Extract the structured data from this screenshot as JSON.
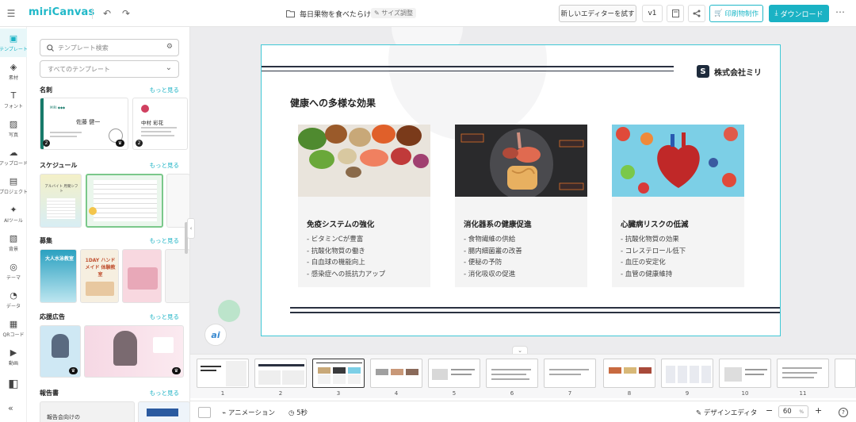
{
  "app": {
    "logo": "miriCanvas"
  },
  "topbar": {
    "doc_title": "毎日果物を食べたらけれ…",
    "size_label": "サイズ調整",
    "try_editor": "新しいエディターを試す",
    "version": "v1",
    "print_label": "印刷物制作",
    "download_label": "ダウンロード"
  },
  "rail": {
    "items": [
      {
        "label": "テンプレート",
        "icon": "template-icon"
      },
      {
        "label": "素材",
        "icon": "elements-icon"
      },
      {
        "label": "フォント",
        "icon": "font-icon"
      },
      {
        "label": "写真",
        "icon": "photo-icon"
      },
      {
        "label": "アップロード",
        "icon": "upload-icon"
      },
      {
        "label": "プロジェクト",
        "icon": "project-icon"
      },
      {
        "label": "AIツール",
        "icon": "ai-tool-icon"
      },
      {
        "label": "背景",
        "icon": "background-icon"
      },
      {
        "label": "テーマ",
        "icon": "theme-icon"
      },
      {
        "label": "データ",
        "icon": "data-icon"
      },
      {
        "label": "QRコード",
        "icon": "qr-icon"
      },
      {
        "label": "動画",
        "icon": "video-icon"
      },
      {
        "label": "",
        "icon": "bookmark-icon"
      }
    ]
  },
  "panel": {
    "search_placeholder": "テンプレート検索",
    "select_value": "すべてのテンプレート",
    "more_label": "もっと見る",
    "categories": [
      {
        "title": "名刺",
        "more": "もっと見る"
      },
      {
        "title": "スケジュール",
        "more": "もっと見る"
      },
      {
        "title": "募集",
        "more": "もっと見る"
      },
      {
        "title": "応援広告",
        "more": "もっと見る"
      },
      {
        "title": "報告書",
        "more": "もっと見る"
      }
    ],
    "thumb_texts": {
      "card1_name": "佐藤 健一",
      "card2_name": "中村 彩花",
      "schedule1": "アルバイト 月間シフト",
      "recruit1": "大人水泳教室",
      "recruit2": "1DAY ハンドメイド 体験教室",
      "report1": "報告会向けの"
    },
    "badges": [
      "2",
      "2"
    ]
  },
  "slide": {
    "company": "株式会社ミリ",
    "title": "健康への多様な効果",
    "cards": [
      {
        "heading": "免疫システムの強化",
        "bullets": [
          "- ビタミンCが豊富",
          "- 抗酸化物質の働き",
          "- 白血球の機能向上",
          "- 感染症への抵抗力アップ"
        ]
      },
      {
        "heading": "消化器系の健康促進",
        "bullets": [
          "- 食物繊維の供給",
          "- 腸内細菌叢の改善",
          "- 便秘の予防",
          "- 消化吸収の促進"
        ]
      },
      {
        "heading": "心臓病リスクの低減",
        "bullets": [
          "- 抗酸化物質の効果",
          "- コレステロール低下",
          "- 血圧の安定化",
          "- 血管の健康維持"
        ]
      }
    ]
  },
  "pages": {
    "numbers": [
      "1",
      "2",
      "3",
      "4",
      "5",
      "6",
      "7",
      "8",
      "9",
      "10",
      "11"
    ],
    "active": "3"
  },
  "bottombar": {
    "animation": "アニメーション",
    "duration": "5秒",
    "design_editor": "デザインエディタ",
    "zoom": "60",
    "zoom_unit": "%"
  },
  "colors": {
    "accent": "#1ab2c4",
    "slide_border": "#40c8d6",
    "navy": "#1e2b3c"
  }
}
